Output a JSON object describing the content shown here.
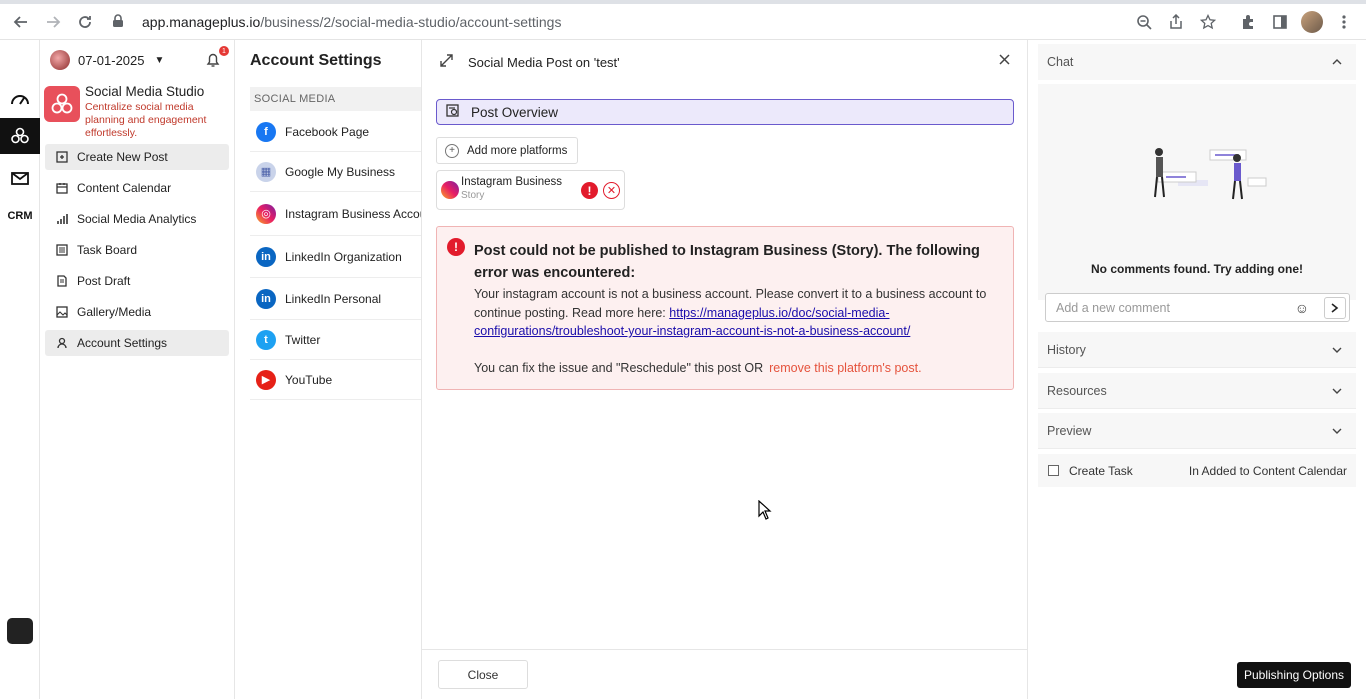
{
  "browser": {
    "url_host": "app.manageplus.io",
    "url_path": "/business/2/social-media-studio/account-settings"
  },
  "sidebar": {
    "date": "07-01-2025",
    "notification_count": "1",
    "studio_title": "Social Media Studio",
    "studio_subtitle": "Centralize social media planning and engagement effortlessly.",
    "rail_crm_label": "CRM",
    "items": [
      {
        "label": "Create New Post",
        "icon": "create-post-icon"
      },
      {
        "label": "Content Calendar",
        "icon": "calendar-icon"
      },
      {
        "label": "Social Media Analytics",
        "icon": "analytics-icon"
      },
      {
        "label": "Task Board",
        "icon": "task-board-icon"
      },
      {
        "label": "Post Draft",
        "icon": "draft-icon"
      },
      {
        "label": "Gallery/Media",
        "icon": "gallery-icon"
      },
      {
        "label": "Account Settings",
        "icon": "user-icon"
      }
    ]
  },
  "account_settings": {
    "title": "Account Settings",
    "section": "SOCIAL MEDIA",
    "platforms": [
      {
        "label": "Facebook Page",
        "color": "#1877f2"
      },
      {
        "label": "Google My Business",
        "color": "#c9d3ea"
      },
      {
        "label": "Instagram Business Account",
        "color": "#e1306c"
      },
      {
        "label": "LinkedIn Organization",
        "color": "#0a66c2"
      },
      {
        "label": "LinkedIn Personal",
        "color": "#0a66c2"
      },
      {
        "label": "Twitter",
        "color": "#1da1f2"
      },
      {
        "label": "YouTube",
        "color": "#e62117"
      }
    ]
  },
  "modal": {
    "title": "Social Media Post on 'test'",
    "overview": "Post Overview",
    "add_platforms": "Add more platforms",
    "platform_name": "Instagram Business",
    "platform_type": "Story",
    "error_title": "Post could not be published to Instagram Business (Story). The following error was encountered:",
    "error_body": "Your instagram account is not a business account. Please convert it to a business account to continue posting. Read more here: ",
    "error_link": "https://manageplus.io/doc/social-media-configurations/troubleshoot-your-instagram-account-is-not-a-business-account/",
    "fix_text": "You can fix the issue and \"Reschedule\" this post OR",
    "remove_link": "remove this platform's post.",
    "close_label": "Close"
  },
  "right_panel": {
    "chat_label": "Chat",
    "no_comments": "No comments found. Try adding one!",
    "comment_placeholder": "Add a new comment",
    "history_label": "History",
    "resources_label": "Resources",
    "preview_label": "Preview",
    "create_task_label": "Create Task",
    "task_status": "In Added to Content Calendar",
    "publish_label": "Publishing Options"
  },
  "colors": {
    "accent": "#6a5acd",
    "error": "#e21b2c",
    "studio": "#e8505b"
  }
}
